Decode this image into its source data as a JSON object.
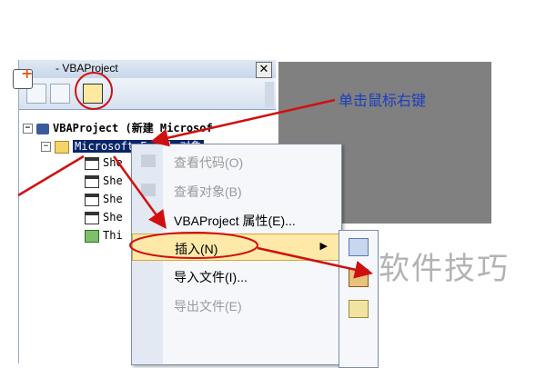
{
  "project_window": {
    "title": "- VBAProject",
    "close_glyph": "✕"
  },
  "tree": {
    "root": {
      "label": "VBAProject (新建 Microsof",
      "expander": "−"
    },
    "folder": {
      "label": "Microsoft Excel 对象",
      "expander": "−"
    },
    "sheets": [
      "She",
      "She",
      "She",
      "She"
    ],
    "workbook": "Thi"
  },
  "context_menu": {
    "items": [
      {
        "label": "查看代码(O)",
        "state": "disabled"
      },
      {
        "label": "查看对象(B)",
        "state": "disabled"
      },
      {
        "label": "VBAProject 属性(E)...",
        "state": "normal"
      },
      {
        "label": "插入(N)",
        "state": "highlighted",
        "submenu_arrow": "▶"
      },
      {
        "label": "导入文件(I)...",
        "state": "normal"
      },
      {
        "label": "导出文件(E)",
        "state": "disabled"
      }
    ]
  },
  "annotation": {
    "text": "单击鼠标右键",
    "color": "#1a3dbe",
    "arrow_color": "#d01010"
  },
  "watermark": "软件技巧",
  "icons": [
    "add-icon",
    "folder-icon",
    "project-icon",
    "sheet-icon",
    "workbook-icon",
    "userform-icon",
    "module-icon",
    "class-module-icon"
  ]
}
